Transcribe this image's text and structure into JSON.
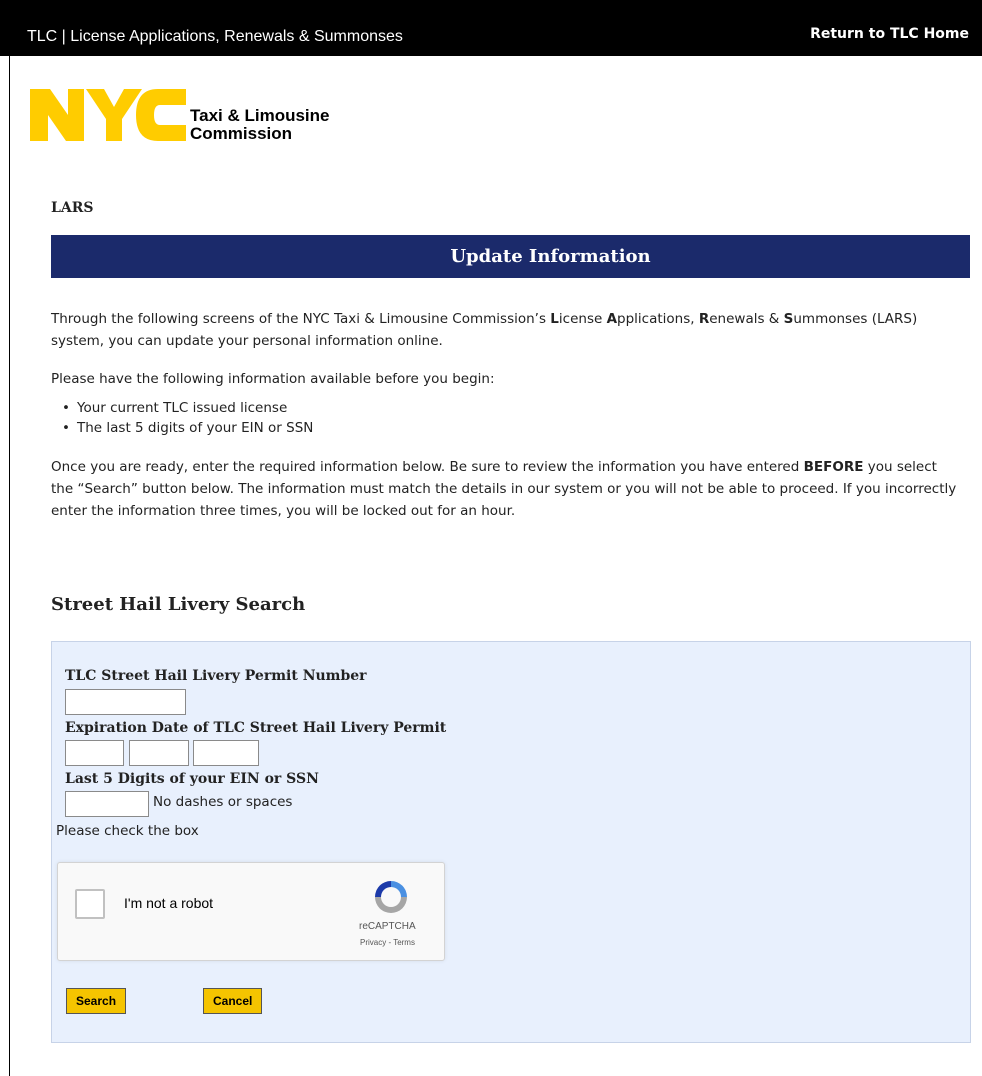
{
  "topbar": {
    "title": "TLC | License Applications, Renewals & Summonses",
    "home_link": "Return to TLC Home"
  },
  "logo": {
    "mark": "NYC",
    "line1": "Taxi & Limousine",
    "line2": "Commission"
  },
  "page": {
    "section_label": "LARS",
    "banner_title": "Update Information"
  },
  "intro": {
    "p1_a": "Through the following screens of the NYC Taxi & Limousine Commission’s ",
    "p1_L": "L",
    "p1_b": "icense ",
    "p1_A": "A",
    "p1_c": "pplications, ",
    "p1_R": "R",
    "p1_d": "enewals & ",
    "p1_S": "S",
    "p1_e": "ummonses (LARS) system, you can update your personal information online.",
    "p2": "Please have the following information available before you begin:",
    "bullets": [
      "Your current TLC issued license",
      "The last 5 digits of your EIN or SSN"
    ],
    "p3_a": "Once you are ready, enter the required information below. Be sure to review the information you have entered ",
    "p3_bold": "BEFORE",
    "p3_b": " you select the “Search” button below. The information must match the details in our system or you will not be able to proceed. If you incorrectly enter the information three times, you will be locked out for an hour."
  },
  "search": {
    "title": "Street Hail Livery Search",
    "permit_label": "TLC Street Hail Livery Permit Number",
    "permit_value": "",
    "expiration_label": "Expiration Date of TLC Street Hail Livery Permit",
    "exp_month": "",
    "exp_day": "",
    "exp_year": "",
    "ssn_label": "Last 5 Digits of your EIN or SSN",
    "ssn_value": "",
    "ssn_hint": "No dashes or spaces",
    "check_prompt": "Please check the box"
  },
  "captcha": {
    "label": "I'm not a robot",
    "brand": "reCAPTCHA",
    "links": "Privacy - Terms"
  },
  "buttons": {
    "search": "Search",
    "cancel": "Cancel"
  },
  "colors": {
    "banner": "#1b2a6b",
    "button": "#f5c400",
    "panel": "#e8f0fd",
    "logo_yellow": "#ffcc00"
  }
}
